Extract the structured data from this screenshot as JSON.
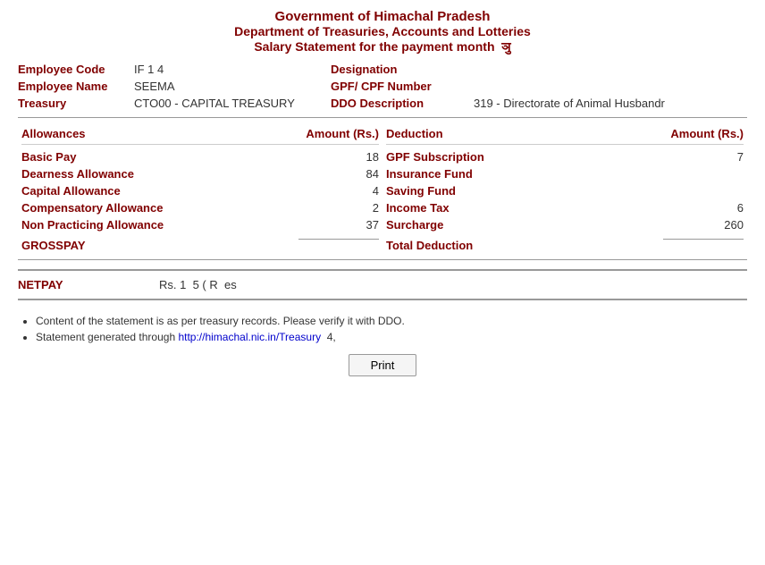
{
  "header": {
    "line1": "Government of Himachal Pradesh",
    "line2": "Department of Treasuries, Accounts and Lotteries",
    "line3": "Salary Statement for the payment month",
    "month": "ञु"
  },
  "employee": {
    "code_label": "Employee Code",
    "code_value": "IF  1   4",
    "name_label": "Employee Name",
    "name_value": "SEEMA",
    "designation_label": "Designation",
    "designation_value": "",
    "gpf_label": "GPF/ CPF Number",
    "gpf_value": "",
    "treasury_label": "Treasury",
    "treasury_value": "CTO00 - CAPITAL TREASURY",
    "ddo_label": "DDO Description",
    "ddo_value": "319 - Directorate of Animal Husbandr"
  },
  "allowances": {
    "col_label": "Allowances",
    "amount_label": "Amount (Rs.)",
    "items": [
      {
        "label": "Basic Pay",
        "value": "18"
      },
      {
        "label": "Dearness Allowance",
        "value": "84"
      },
      {
        "label": "Capital Allowance",
        "value": "4"
      },
      {
        "label": "Compensatory Allowance",
        "value": "2"
      },
      {
        "label": "Non Practicing Allowance",
        "value": "37"
      }
    ],
    "grosspay_label": "GROSSPAY",
    "grosspay_value": ""
  },
  "deductions": {
    "col_label": "Deduction",
    "amount_label": "Amount (Rs.)",
    "items": [
      {
        "label": "GPF Subscription",
        "value": "7"
      },
      {
        "label": "Insurance Fund",
        "value": ""
      },
      {
        "label": "Saving Fund",
        "value": ""
      },
      {
        "label": "Income Tax",
        "value": "6"
      },
      {
        "label": "Surcharge",
        "value": "260"
      }
    ],
    "total_label": "Total Deduction",
    "total_value": ""
  },
  "netpay": {
    "label": "NETPAY",
    "value": "Rs. 1",
    "suffix": "5  ( R",
    "extra": "es"
  },
  "footer": {
    "note1": "Content of the statement is as per treasury records. Please verify it with DDO.",
    "note2_prefix": "Statement generated through ",
    "note2_link": "http://himachal.nic.in/Treasury",
    "note2_suffix": "4,"
  },
  "print_button": "Print"
}
